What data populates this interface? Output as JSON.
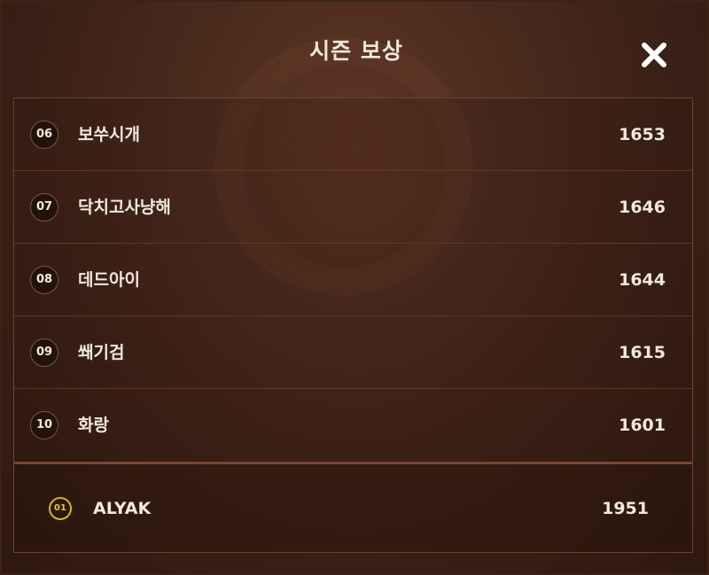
{
  "dialog": {
    "title": "시즌 보상",
    "close_icon": "close-icon"
  },
  "leaderboard": {
    "rows": [
      {
        "rank": "06",
        "name": "보쑤시개",
        "score": "1653"
      },
      {
        "rank": "07",
        "name": "닥치고사냥해",
        "score": "1646"
      },
      {
        "rank": "08",
        "name": "데드아이",
        "score": "1644"
      },
      {
        "rank": "09",
        "name": "쐐기검",
        "score": "1615"
      },
      {
        "rank": "10",
        "name": "화랑",
        "score": "1601"
      }
    ]
  },
  "my_entry": {
    "rank": "01",
    "name": "ALYAK",
    "score": "1951"
  },
  "colors": {
    "panel_bg": "#4a2a1d",
    "text": "#f0e8e1",
    "divider": "#5e3828",
    "my_rank_accent": "#d4b224"
  }
}
